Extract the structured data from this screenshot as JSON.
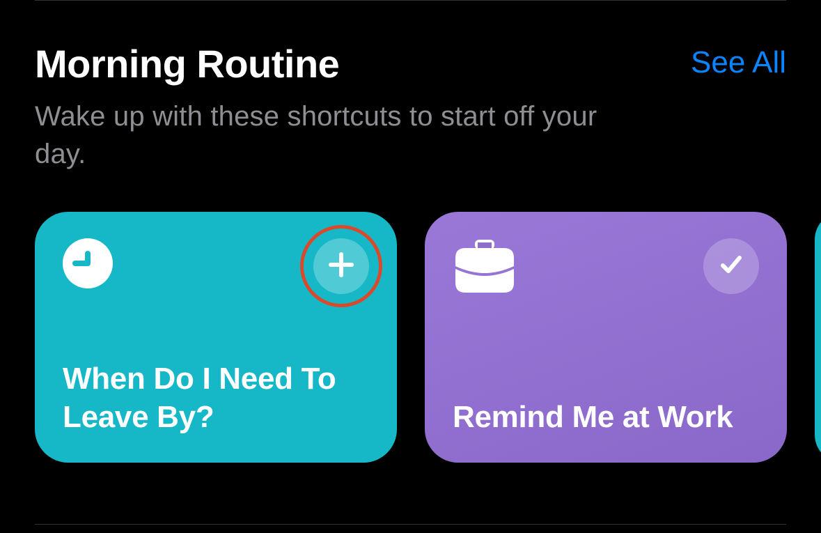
{
  "section": {
    "title": "Morning Routine",
    "subtitle": "Wake up with these shortcuts to start off your day.",
    "see_all": "See All"
  },
  "cards": [
    {
      "title": "When Do I Need To Leave By?",
      "icon": "clock-icon",
      "action": "plus-icon",
      "color": "#16b8c7",
      "highlighted": true
    },
    {
      "title": "Remind Me at Work",
      "icon": "briefcase-icon",
      "action": "checkmark-icon",
      "color": "#8e6fc9",
      "highlighted": false
    }
  ],
  "colors": {
    "link": "#0a84ff",
    "highlight_ring": "#d84a2b"
  }
}
